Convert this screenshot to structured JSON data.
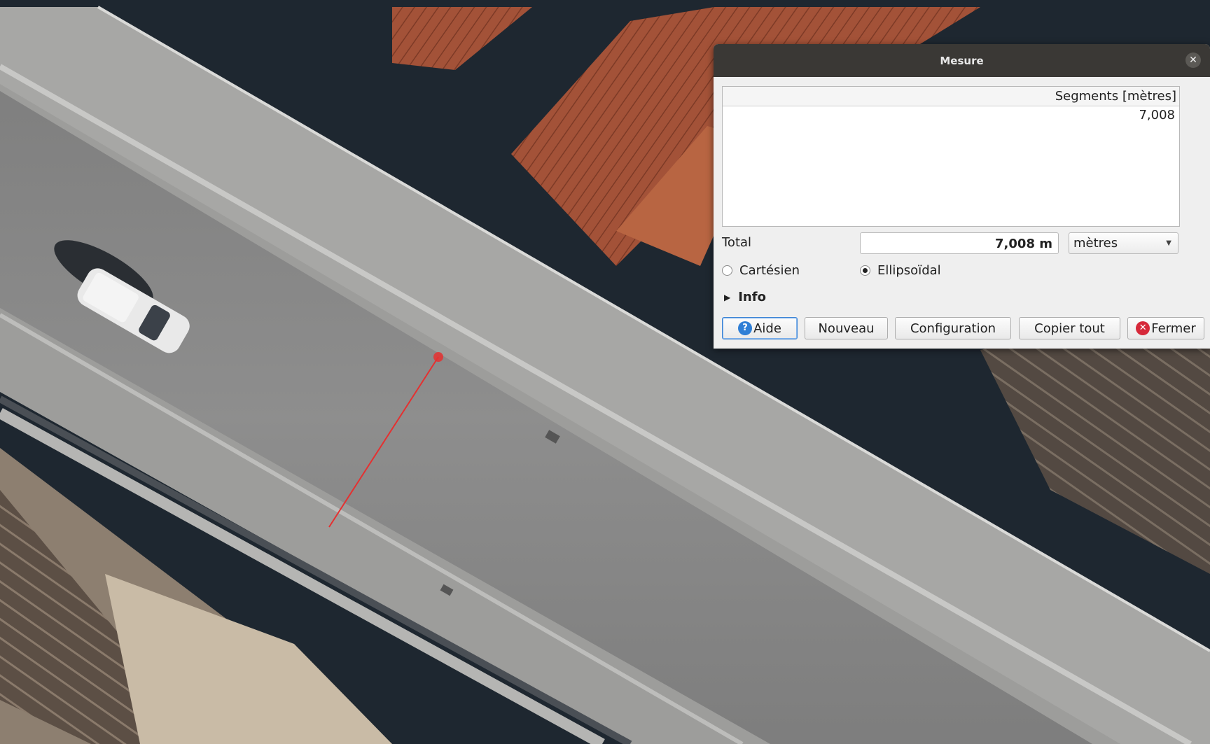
{
  "dialog": {
    "title": "Mesure",
    "close_glyph": "✕",
    "table": {
      "column_header": "Segments [mètres]",
      "rows": [
        "7,008"
      ]
    },
    "total": {
      "label": "Total",
      "value": "7,008 m",
      "unit_selected": "mètres"
    },
    "modes": [
      {
        "label": "Cartésien",
        "selected": false
      },
      {
        "label": "Ellipsoïdal",
        "selected": true
      }
    ],
    "info_label": "Info",
    "buttons": {
      "help": "Aide",
      "new": "Nouveau",
      "config": "Configuration",
      "copy": "Copier tout",
      "close": "Fermer"
    }
  },
  "icons": {
    "help_glyph": "?",
    "close_glyph": "✕",
    "expand_glyph": "▶",
    "dropdown_glyph": "▼"
  },
  "colors": {
    "measure_line": "#e53030",
    "annotation_arrow": "#ff0000",
    "titlebar": "#3a3835"
  }
}
